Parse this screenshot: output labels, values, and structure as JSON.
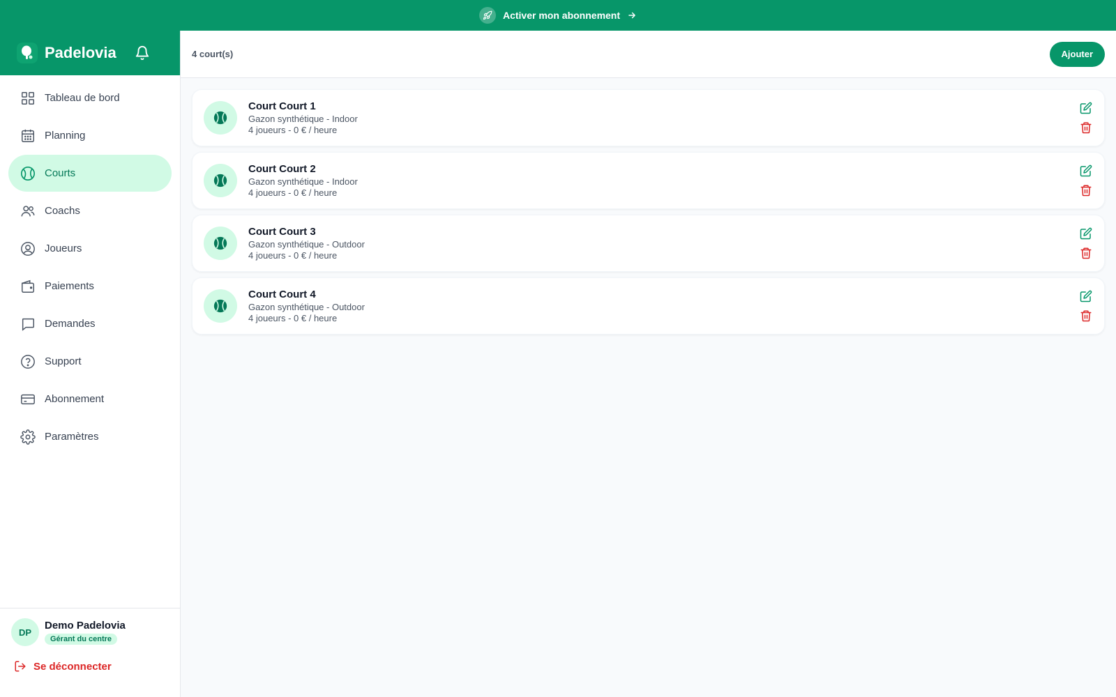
{
  "banner": {
    "text": "Activer mon abonnement",
    "icon": "rocket-icon",
    "arrow_icon": "arrow-right-icon"
  },
  "brand": {
    "name": "Padelovia",
    "icon": "padel-logo-icon",
    "bell_icon": "bell-icon"
  },
  "sidebar": {
    "items": [
      {
        "label": "Tableau de bord",
        "icon": "dashboard-grid-icon",
        "active": false
      },
      {
        "label": "Planning",
        "icon": "calendar-icon",
        "active": false
      },
      {
        "label": "Courts",
        "icon": "court-ball-icon",
        "active": true
      },
      {
        "label": "Coachs",
        "icon": "users-icon",
        "active": false
      },
      {
        "label": "Joueurs",
        "icon": "user-circle-icon",
        "active": false
      },
      {
        "label": "Paiements",
        "icon": "wallet-icon",
        "active": false
      },
      {
        "label": "Demandes",
        "icon": "chat-icon",
        "active": false
      },
      {
        "label": "Support",
        "icon": "help-circle-icon",
        "active": false
      },
      {
        "label": "Abonnement",
        "icon": "credit-card-icon",
        "active": false
      },
      {
        "label": "Paramètres",
        "icon": "settings-icon",
        "active": false
      }
    ]
  },
  "user": {
    "initials": "DP",
    "name": "Demo Padelovia",
    "role": "Gérant du centre"
  },
  "logout": {
    "label": "Se déconnecter"
  },
  "header": {
    "count": "4 court(s)",
    "add_label": "Ajouter"
  },
  "courts": [
    {
      "title": "Court Court 1",
      "subtitle": "Gazon synthétique - Indoor",
      "meta": "4 joueurs - 0 € / heure"
    },
    {
      "title": "Court Court 2",
      "subtitle": "Gazon synthétique - Indoor",
      "meta": "4 joueurs - 0 € / heure"
    },
    {
      "title": "Court Court 3",
      "subtitle": "Gazon synthétique - Outdoor",
      "meta": "4 joueurs - 0 € / heure"
    },
    {
      "title": "Court Court 4",
      "subtitle": "Gazon synthétique - Outdoor",
      "meta": "4 joueurs - 0 € / heure"
    }
  ],
  "colors": {
    "brand": "#079669",
    "active_bg": "#d1fae5",
    "danger": "#dc2626"
  }
}
